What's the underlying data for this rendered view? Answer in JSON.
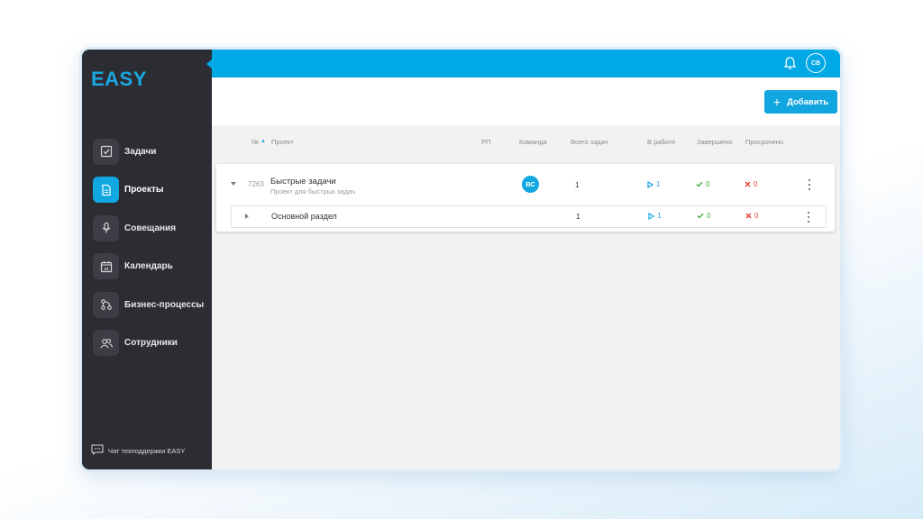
{
  "app": {
    "logo": "EASY"
  },
  "sidebar": {
    "items": [
      {
        "label": "Задачи",
        "icon": "checkbox-icon",
        "active": false
      },
      {
        "label": "Проекты",
        "icon": "document-icon",
        "active": true
      },
      {
        "label": "Совещания",
        "icon": "microphone-icon",
        "active": false
      },
      {
        "label": "Календарь",
        "icon": "calendar-icon",
        "active": false
      },
      {
        "label": "Бизнес-процессы",
        "icon": "flow-icon",
        "active": false
      },
      {
        "label": "Сотрудники",
        "icon": "users-icon",
        "active": false
      }
    ],
    "calendar_day": "31",
    "support_label": "Чат техподдержки EASY"
  },
  "topbar": {
    "avatar_initials": "СВ",
    "bell_icon": "bell-icon"
  },
  "actionbar": {
    "add_label": "Добавить"
  },
  "table": {
    "headers": {
      "number": "№",
      "project": "Проект",
      "pm": "РП",
      "team": "Команда",
      "total": "Всего задач",
      "in_work": "В работе",
      "done": "Завершено",
      "overdue": "Просрочено"
    },
    "rows": [
      {
        "id": "7263",
        "name": "Быстрые задачи",
        "description": "Проект для быстрых задач",
        "team_initials": "ВС",
        "total": "1",
        "in_work": "1",
        "done": "0",
        "overdue": "0",
        "sections": [
          {
            "name": "Основной раздел",
            "total": "1",
            "in_work": "1",
            "done": "0",
            "overdue": "0"
          }
        ]
      }
    ]
  },
  "colors": {
    "accent": "#00a9e6",
    "sidebar_bg": "#2c2d33",
    "in_work": "#1aa6e0",
    "done": "#38a838",
    "overdue": "#e53935"
  }
}
